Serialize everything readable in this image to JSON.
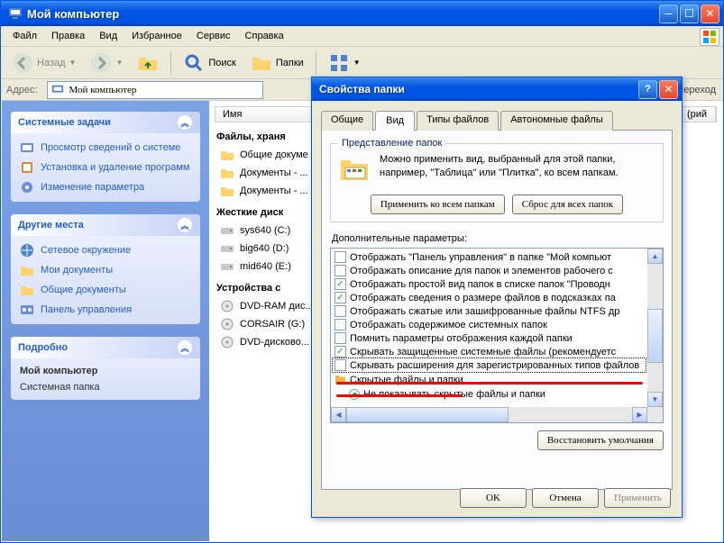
{
  "window": {
    "title": "Мой компьютер",
    "menu": [
      "Файл",
      "Правка",
      "Вид",
      "Избранное",
      "Сервис",
      "Справка"
    ],
    "toolbar": {
      "back": "Назад",
      "search": "Поиск",
      "folders": "Папки"
    },
    "address_label": "Адрес:",
    "address_value": "Мой компьютер",
    "goto": "Переход"
  },
  "sidebar": {
    "panels": [
      {
        "title": "Системные задачи",
        "items": [
          "Просмотр сведений о системе",
          "Установка и удаление программ",
          "Изменение параметра"
        ]
      },
      {
        "title": "Другие места",
        "items": [
          "Сетевое окружение",
          "Мои документы",
          "Общие документы",
          "Панель управления"
        ]
      },
      {
        "title": "Подробно",
        "details_line1": "Мой компьютер",
        "details_line2": "Системная папка"
      }
    ]
  },
  "main": {
    "col_name": "Имя",
    "col_other": "(рий",
    "sections": [
      {
        "label": "Файлы, храня",
        "items": [
          "Общие докуме",
          "Документы - ...",
          "Документы - ..."
        ],
        "icon": "folder"
      },
      {
        "label": "Жесткие диск",
        "items": [
          "sys640 (C:)",
          "big640 (D:)",
          "mid640 (E:)"
        ],
        "icon": "drive"
      },
      {
        "label": "Устройства с",
        "items": [
          "DVD-RAM дис...",
          "CORSAIR (G:)",
          "DVD-дисково..."
        ],
        "icon": "cd"
      }
    ]
  },
  "dialog": {
    "title": "Свойства папки",
    "tabs": [
      "Общие",
      "Вид",
      "Типы файлов",
      "Автономные файлы"
    ],
    "active_tab": 1,
    "group_title": "Представление папок",
    "group_text1": "Можно применить вид, выбранный для этой папки,",
    "group_text2": "например, \"Таблица\" или \"Плитка\", ко всем папкам.",
    "apply_all": "Применить ко всем папкам",
    "reset_all": "Сброс для всех папок",
    "adv_label": "Дополнительные параметры:",
    "adv_items": [
      {
        "type": "check",
        "checked": false,
        "text": "Отображать \"Панель управления\" в папке \"Мой компьют"
      },
      {
        "type": "check",
        "checked": false,
        "text": "Отображать описание для папок и элементов рабочего с"
      },
      {
        "type": "check",
        "checked": true,
        "text": "Отображать простой вид папок в списке папок \"Проводн"
      },
      {
        "type": "check",
        "checked": true,
        "text": "Отображать сведения о размере файлов в подсказках па"
      },
      {
        "type": "check",
        "checked": false,
        "text": "Отображать сжатые или зашифрованные файлы NTFS др"
      },
      {
        "type": "check",
        "checked": false,
        "text": "Отображать содержимое системных папок"
      },
      {
        "type": "check",
        "checked": false,
        "text": "Помнить параметры отображения каждой папки"
      },
      {
        "type": "check",
        "checked": true,
        "text": "Скрывать защищенные системные файлы (рекомендуетс"
      },
      {
        "type": "check",
        "checked": false,
        "text": "Скрывать расширения для зарегистрированных типов файлов",
        "selected": true
      },
      {
        "type": "label",
        "text": "Скрытые файлы и папки"
      },
      {
        "type": "radio",
        "checked": true,
        "text": "Не показывать скрытые файлы и папки"
      }
    ],
    "restore": "Восстановить умолчания",
    "ok": "OK",
    "cancel": "Отмена",
    "apply": "Применить"
  }
}
